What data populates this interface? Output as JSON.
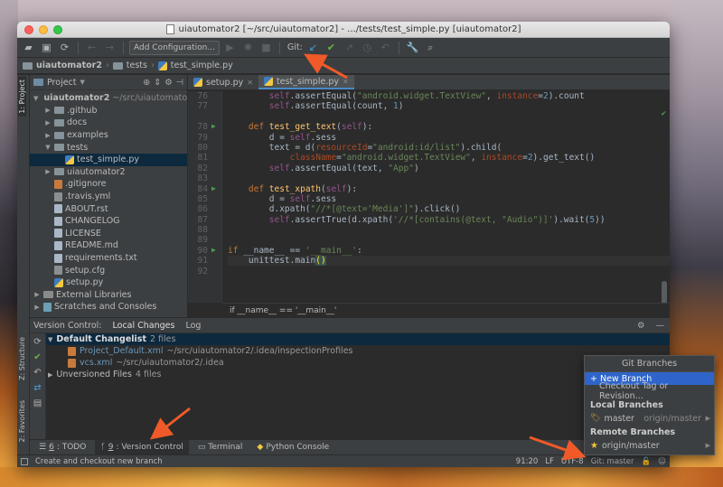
{
  "window": {
    "title": "uiautomator2 [~/src/uiautomator2] - .../tests/test_simple.py [uiautomator2]"
  },
  "toolbar": {
    "add_config_label": "Add Configuration...",
    "git_label": "Git:"
  },
  "breadcrumb": {
    "items": [
      "uiautomator2",
      "tests",
      "test_simple.py"
    ]
  },
  "left_strip": {
    "project_tab": "1: Project",
    "structure_tab": "Z: Structure",
    "favorites_tab": "2: Favorites"
  },
  "project_panel": {
    "title": "Project",
    "tree": [
      {
        "label": "uiautomator2",
        "path": "~/src/uiautomator2",
        "indent": 0,
        "type": "folder-root",
        "expanded": true
      },
      {
        "label": ".github",
        "indent": 1,
        "type": "folder"
      },
      {
        "label": "docs",
        "indent": 1,
        "type": "folder"
      },
      {
        "label": "examples",
        "indent": 1,
        "type": "folder"
      },
      {
        "label": "tests",
        "indent": 1,
        "type": "folder",
        "expanded": true
      },
      {
        "label": "test_simple.py",
        "indent": 2,
        "type": "py"
      },
      {
        "label": "uiautomator2",
        "indent": 1,
        "type": "folder"
      },
      {
        "label": ".gitignore",
        "indent": 1,
        "type": "git"
      },
      {
        "label": ".travis.yml",
        "indent": 1,
        "type": "file"
      },
      {
        "label": "ABOUT.rst",
        "indent": 1,
        "type": "txt"
      },
      {
        "label": "CHANGELOG",
        "indent": 1,
        "type": "txt"
      },
      {
        "label": "LICENSE",
        "indent": 1,
        "type": "txt"
      },
      {
        "label": "README.md",
        "indent": 1,
        "type": "txt"
      },
      {
        "label": "requirements.txt",
        "indent": 1,
        "type": "txt"
      },
      {
        "label": "setup.cfg",
        "indent": 1,
        "type": "file"
      },
      {
        "label": "setup.py",
        "indent": 1,
        "type": "py"
      },
      {
        "label": "External Libraries",
        "indent": 0,
        "type": "lib"
      },
      {
        "label": "Scratches and Consoles",
        "indent": 0,
        "type": "scratch"
      }
    ]
  },
  "editor": {
    "tabs": [
      {
        "label": "setup.py",
        "active": false
      },
      {
        "label": "test_simple.py",
        "active": true
      }
    ],
    "lines": [
      {
        "n": "76",
        "html": "        <span class=\"self\">self</span>.assertEqual(<span class=\"str\">\"android.widget.TextView\"</span>, <span class=\"kwarg\">instance</span>=<span class=\"num\">2</span>).count"
      },
      {
        "n": "77",
        "html": "        <span class=\"self\">self</span>.assertEqual(count, <span class=\"num\">1</span>)"
      },
      {
        "n": "",
        "html": ""
      },
      {
        "n": "78",
        "run": true,
        "html": "    <span class=\"kw\">def</span> <span class=\"fn\">test_get_text</span>(<span class=\"self\">self</span>):"
      },
      {
        "n": "79",
        "html": "        d = <span class=\"self\">self</span>.sess"
      },
      {
        "n": "80",
        "html": "        text = d(<span class=\"kwarg\">resourceId</span>=<span class=\"str\">\"android:id/list\"</span>).child("
      },
      {
        "n": "81",
        "html": "            <span class=\"kwarg\">className</span>=<span class=\"str\">\"android.widget.TextView\"</span>, <span class=\"kwarg\">instance</span>=<span class=\"num\">2</span>).get_text()"
      },
      {
        "n": "82",
        "html": "        <span class=\"self\">self</span>.assertEqual(text, <span class=\"str\">\"App\"</span>)"
      },
      {
        "n": "83",
        "html": ""
      },
      {
        "n": "84",
        "run": true,
        "html": "    <span class=\"kw\">def</span> <span class=\"fn\">test_xpath</span>(<span class=\"self\">self</span>):"
      },
      {
        "n": "85",
        "html": "        d = <span class=\"self\">self</span>.sess"
      },
      {
        "n": "86",
        "html": "        d.xpath(<span class=\"str\">\"//*[@text='Media']\"</span>).click()"
      },
      {
        "n": "87",
        "html": "        <span class=\"self\">self</span>.assertTrue(d.xpath(<span class=\"str\">'//*[contains(@text, \"Audio\")]'</span>).wait(<span class=\"num\">5</span>))"
      },
      {
        "n": "88",
        "html": ""
      },
      {
        "n": "89",
        "html": ""
      },
      {
        "n": "90",
        "run": true,
        "html": "<span class=\"kw\">if</span> __name__ == <span class=\"str\">'__main__'</span>:"
      },
      {
        "n": "91",
        "cur": true,
        "html": "    unittest.main<span class=\"bracket\">()</span>"
      },
      {
        "n": "92",
        "html": ""
      }
    ],
    "status": "if __name__ == '__main__'"
  },
  "version_control": {
    "label": "Version Control:",
    "tabs": [
      "Local Changes",
      "Log"
    ],
    "changelist": {
      "name": "Default Changelist",
      "count": "2 files"
    },
    "files": [
      {
        "name": "Project_Default.xml",
        "path": "~/src/uiautomator2/.idea/inspectionProfiles"
      },
      {
        "name": "vcs.xml",
        "path": "~/src/uiautomator2/.idea"
      }
    ],
    "unversioned": {
      "name": "Unversioned Files",
      "count": "4 files"
    }
  },
  "bottom_tabs": [
    {
      "num": "6",
      "label": ": TODO"
    },
    {
      "num": "9",
      "label": ": Version Control",
      "active": true
    },
    {
      "label": "Terminal"
    },
    {
      "label": "Python Console"
    }
  ],
  "statusbar": {
    "message": "Create and checkout new branch",
    "position": "91:20",
    "line_sep": "LF",
    "encoding": "UTF-8",
    "branch": "Git: master"
  },
  "git_popup": {
    "title": "Git Branches",
    "new_branch": "+ New Branch",
    "checkout": "Checkout Tag or Revision...",
    "local_section": "Local Branches",
    "local_branch": "master",
    "local_remote": "origin/master",
    "remote_section": "Remote Branches",
    "remote_branch": "origin/master"
  },
  "colors": {
    "accent": "#2f65ca",
    "annotation": "#f05a28"
  }
}
